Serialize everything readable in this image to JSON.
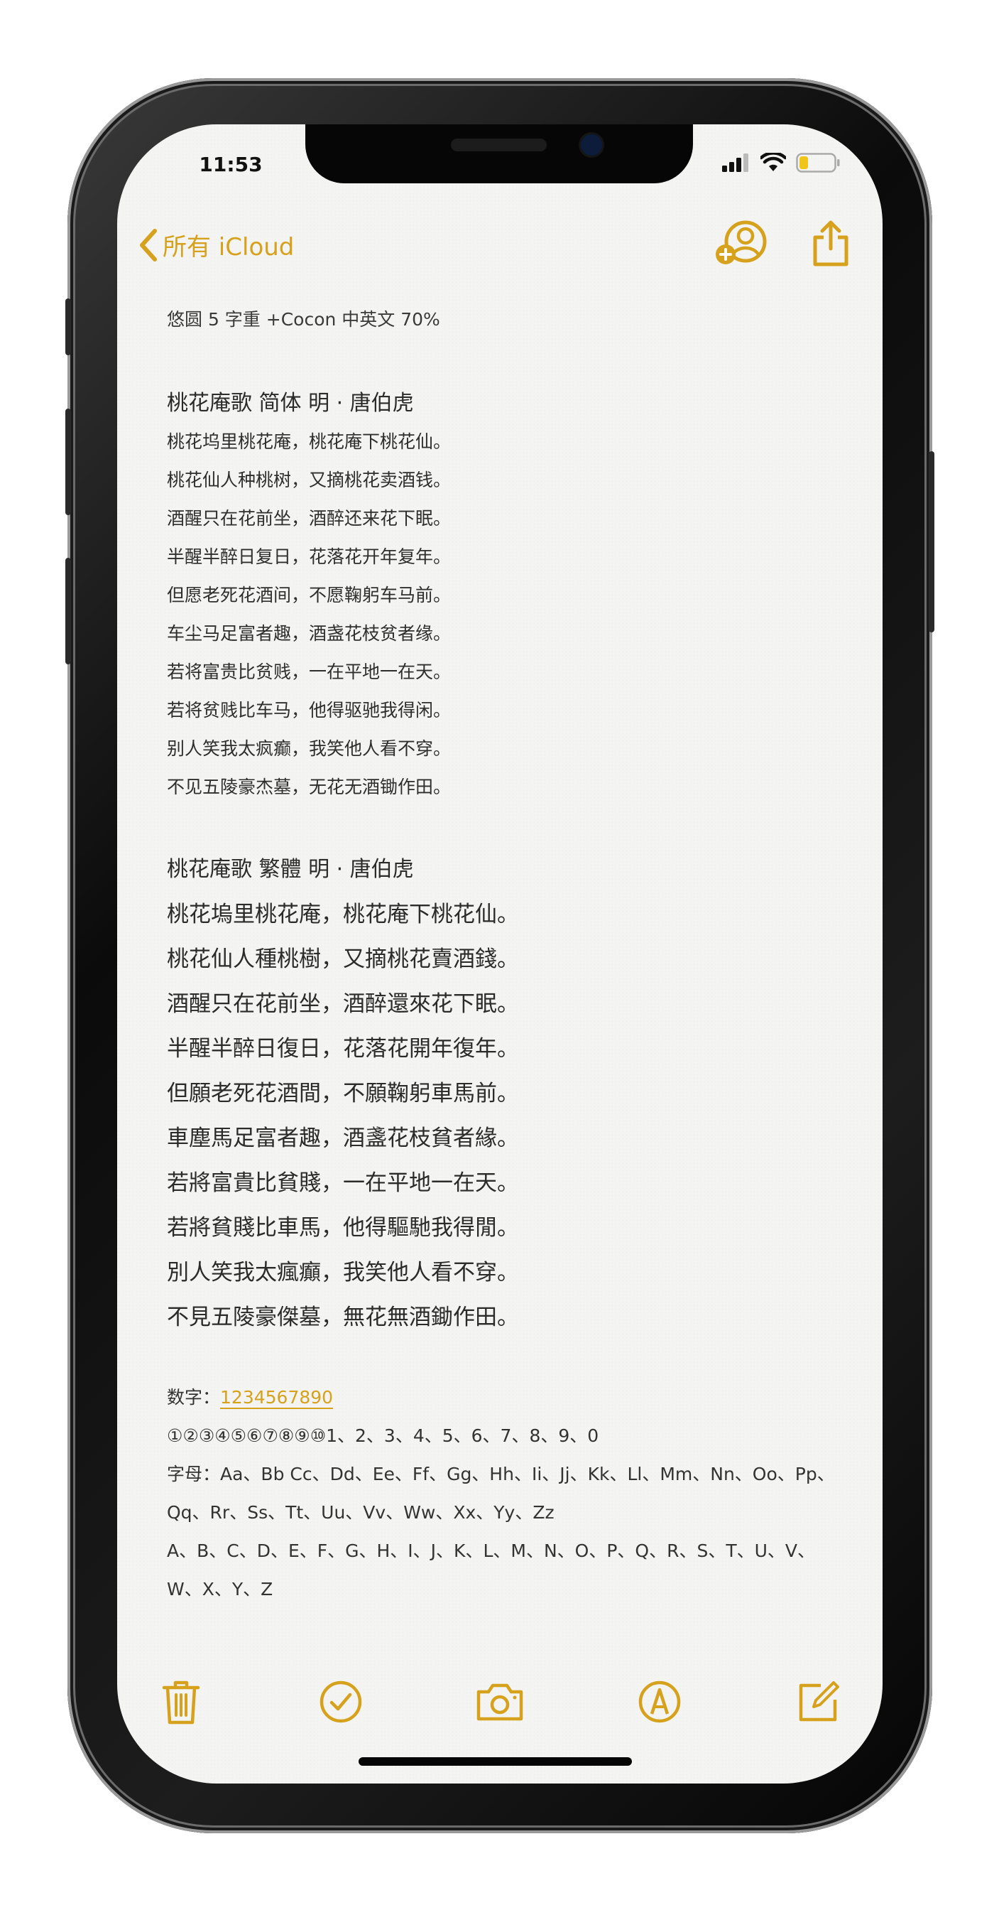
{
  "status_bar": {
    "time": "11:53"
  },
  "nav": {
    "back_label": "所有 iCloud"
  },
  "font_note": "悠圆 5 字重 +Cocon 中英文 70%",
  "simplified": {
    "title": "桃花庵歌 简体  明 · 唐伯虎",
    "lines": [
      "桃花坞里桃花庵，桃花庵下桃花仙。",
      "桃花仙人种桃树，又摘桃花卖酒钱。",
      "酒醒只在花前坐，酒醉还来花下眠。",
      "半醒半醉日复日，花落花开年复年。",
      "但愿老死花酒间，不愿鞠躬车马前。",
      "车尘马足富者趣，酒盏花枝贫者缘。",
      "若将富贵比贫贱，一在平地一在天。",
      "若将贫贱比车马，他得驱驰我得闲。",
      "别人笑我太疯癫，我笑他人看不穿。",
      "不见五陵豪杰墓，无花无酒锄作田。"
    ]
  },
  "traditional": {
    "title": "桃花庵歌 繁體   明 · 唐伯虎",
    "lines": [
      "桃花塢里桃花庵，桃花庵下桃花仙。",
      "桃花仙人種桃樹，又摘桃花賣酒錢。",
      "酒醒只在花前坐，酒醉還來花下眠。",
      "半醒半醉日復日，花落花開年復年。",
      "但願老死花酒間，不願鞠躬車馬前。",
      "車塵馬足富者趣，酒盞花枝貧者緣。",
      "若將富貴比貧賤，一在平地一在天。",
      "若將貧賤比車馬，他得驅馳我得閒。",
      "別人笑我太瘋癲，我笑他人看不穿。",
      "不見五陵豪傑墓，無花無酒鋤作田。"
    ]
  },
  "misc": {
    "digits_label": "数字：",
    "digits_value": "1234567890",
    "circled_line": "①②③④⑤⑥⑦⑧⑨⑩1、2、3、4、5、6、7、8、9、0",
    "letters_line_1": "字母：Aa、Bb Cc、Dd、Ee、Ff、Gg、Hh、Ii、Jj、Kk、Ll、Mm、Nn、Oo、Pp、",
    "letters_line_2": "Qq、Rr、Ss、Tt、Uu、Vv、Ww、Xx、Yy、Zz",
    "caps_line_1": "A、B、C、D、E、F、G、H、I、J、K、L、M、N、O、P、Q、R、S、T、U、V、",
    "caps_line_2": "W、X、Y、Z"
  },
  "colors": {
    "accent": "#d6a11c",
    "text": "#2b2b2b",
    "paper": "#f4f4f2"
  },
  "icons": {
    "nav": [
      "chevron-left-icon",
      "add-person-icon",
      "share-icon"
    ],
    "toolbar": [
      "trash-icon",
      "checkmark-circle-icon",
      "camera-icon",
      "markup-pen-icon",
      "compose-icon"
    ]
  }
}
